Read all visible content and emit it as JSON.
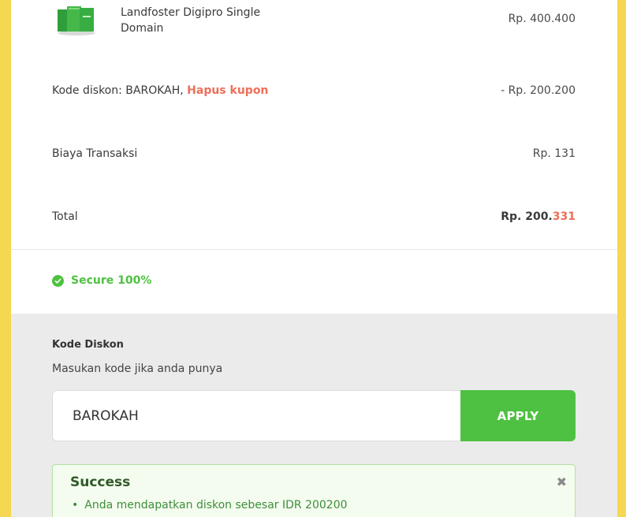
{
  "order": {
    "product": {
      "name": "Landfoster Digipro Single Domain",
      "price": "Rp. 400.400"
    },
    "discount": {
      "prefix": "Kode diskon: BAROKAH,",
      "remove_link": "Hapus kupon",
      "amount": "- Rp. 200.200"
    },
    "fee": {
      "label": "Biaya Transaksi",
      "amount": "Rp. 131"
    },
    "total": {
      "label": "Total",
      "amount_main": "Rp. 200.",
      "amount_accent": "331"
    }
  },
  "secure": {
    "label": "Secure 100%"
  },
  "discount_form": {
    "title": "Kode Diskon",
    "subtitle": "Masukan kode jika anda punya",
    "input_value": "BAROKAH",
    "apply_label": "APPLY"
  },
  "alert": {
    "title": "Success",
    "close": "✖",
    "message": "Anda mendapatkan diskon sebesar IDR 200200"
  },
  "colors": {
    "accent_green": "#4fc142",
    "accent_red": "#ee6f57",
    "frame_yellow": "#f5d751"
  }
}
